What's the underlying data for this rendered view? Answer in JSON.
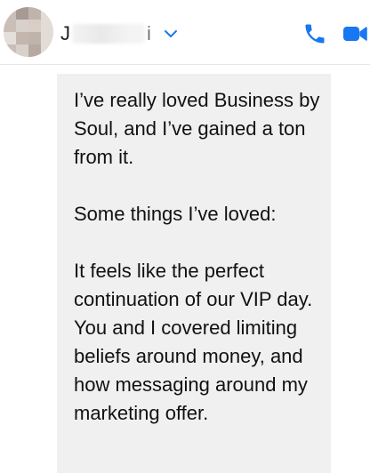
{
  "header": {
    "contact_initial": "J",
    "contact_tail": "i",
    "chevron_icon": "chevron-down-icon",
    "phone_icon": "phone-icon",
    "video_icon": "video-camera-icon",
    "accent_color": "#1877f2"
  },
  "message": {
    "paragraphs": [
      "I’ve really loved Business by Soul, and I’ve gained a ton from it.",
      "Some things I’ve loved:",
      "It feels like the perfect continuation of our VIP day. You and I covered limiting beliefs around money, and how messaging around my marketing offer."
    ],
    "bubble_color": "#f0f0f0"
  }
}
